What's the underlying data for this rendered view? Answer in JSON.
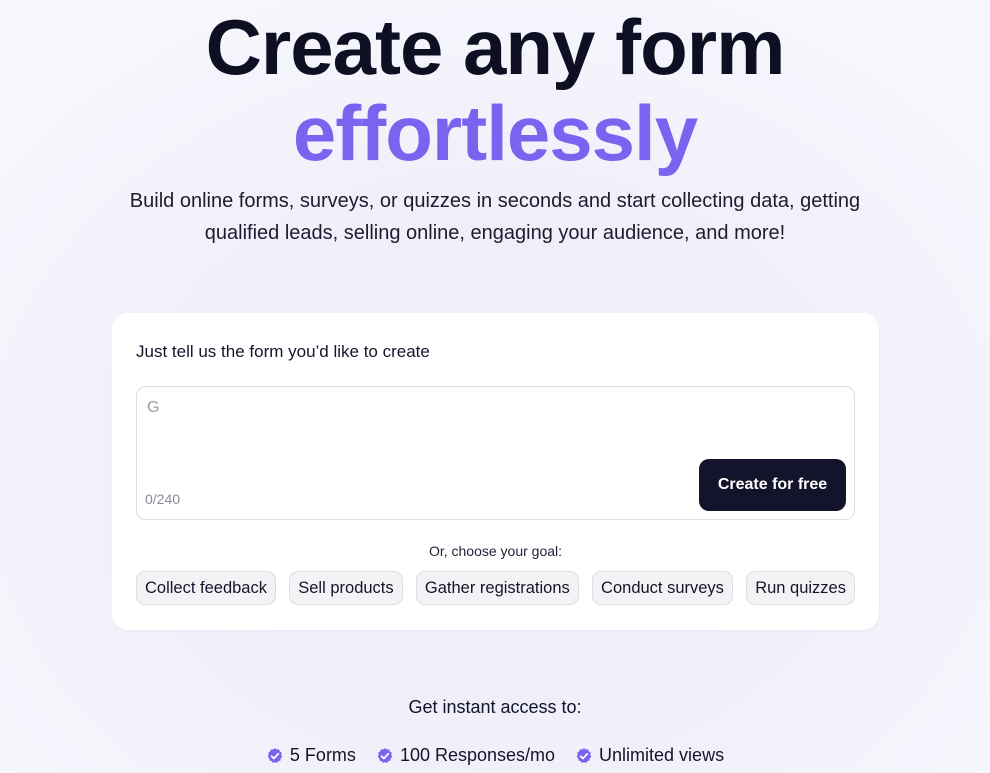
{
  "hero": {
    "title_line1": "Create any form",
    "title_line2": "effortlessly",
    "subtitle": "Build online forms, surveys, or quizzes in seconds and start collecting data, getting qualified leads, selling online, engaging your audience, and more!"
  },
  "card": {
    "label": "Just tell us the form you’d like to create",
    "input_placeholder": "G",
    "counter": "0/240",
    "create_button": "Create for free",
    "goal_label": "Or, choose your goal:",
    "goals": [
      "Collect feedback",
      "Sell products",
      "Gather registrations",
      "Conduct surveys",
      "Run quizzes"
    ]
  },
  "access": {
    "label": "Get instant access to:",
    "features": [
      "5 Forms",
      "100 Responses/mo",
      "Unlimited views"
    ]
  },
  "colors": {
    "accent": "#7b63f0",
    "button_bg": "#13132b",
    "check": "#7b63f0"
  },
  "icons": {
    "feature": "verified-check-icon"
  }
}
